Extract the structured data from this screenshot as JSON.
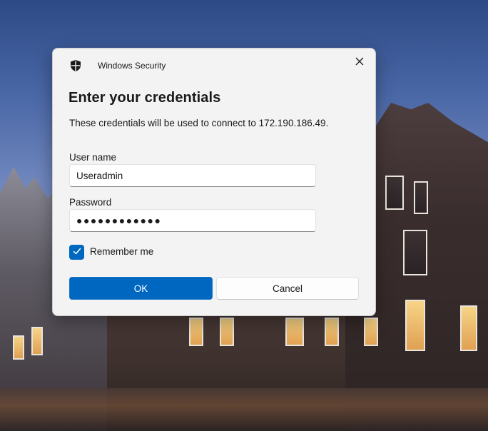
{
  "dialog": {
    "app_title": "Windows Security",
    "heading": "Enter your credentials",
    "description": "These credentials will be used to connect to 172.190.186.49.",
    "username_label": "User name",
    "username_value": "Useradmin",
    "password_label": "Password",
    "password_value": "●●●●●●●●●●●●",
    "remember_label": "Remember me",
    "remember_checked": true,
    "ok_label": "OK",
    "cancel_label": "Cancel"
  },
  "icons": {
    "app": "shield-icon",
    "close": "close-icon",
    "check": "checkmark-icon"
  },
  "colors": {
    "accent": "#0067c0",
    "dialog_bg": "#f3f3f3"
  }
}
